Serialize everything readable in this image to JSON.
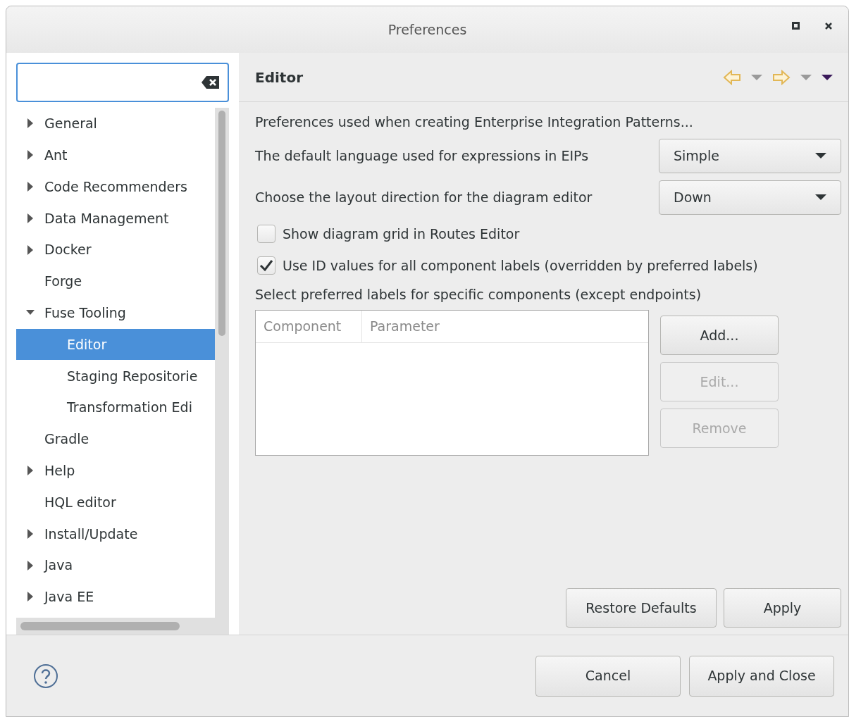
{
  "window": {
    "title": "Preferences"
  },
  "tree": [
    {
      "label": "General",
      "expanded": false,
      "selected": false
    },
    {
      "label": "Ant",
      "expanded": false,
      "selected": false
    },
    {
      "label": "Code Recommenders",
      "expanded": false,
      "selected": false
    },
    {
      "label": "Data Management",
      "expanded": false,
      "selected": false
    },
    {
      "label": "Docker",
      "expanded": false,
      "selected": false
    },
    {
      "label": "Forge",
      "selected": false
    },
    {
      "label": "Fuse Tooling",
      "expanded": true,
      "selected": false,
      "children": [
        {
          "label": "Editor",
          "selected": true
        },
        {
          "label": "Staging Repositorie",
          "selected": false
        },
        {
          "label": "Transformation Edi",
          "selected": false
        }
      ]
    },
    {
      "label": "Gradle",
      "selected": false
    },
    {
      "label": "Help",
      "expanded": false,
      "selected": false
    },
    {
      "label": "HQL editor",
      "selected": false
    },
    {
      "label": "Install/Update",
      "expanded": false,
      "selected": false
    },
    {
      "label": "Java",
      "expanded": false,
      "selected": false
    },
    {
      "label": "Java EE",
      "expanded": false,
      "selected": false
    }
  ],
  "page": {
    "title": "Editor",
    "description": "Preferences used when creating Enterprise Integration Patterns...",
    "settings": [
      {
        "kind": "dropdown",
        "label": "The default language used for expressions in EIPs",
        "value": "Simple"
      },
      {
        "kind": "dropdown",
        "label": "Choose the layout direction for the diagram editor",
        "value": "Down"
      },
      {
        "kind": "checkbox",
        "label": "Show diagram grid in Routes Editor",
        "checked": false
      },
      {
        "kind": "checkbox",
        "label": "Use ID values for all component labels (overridden by preferred labels)",
        "checked": true
      }
    ],
    "labels_caption": "Select preferred labels for specific components (except endpoints)",
    "table": {
      "columns": [
        "Component",
        "Parameter"
      ]
    },
    "table_buttons": [
      {
        "label": "Add...",
        "disabled": false
      },
      {
        "label": "Edit...",
        "disabled": true
      },
      {
        "label": "Remove",
        "disabled": true
      }
    ],
    "page_buttons": [
      "Restore Defaults",
      "Apply"
    ]
  },
  "dialog_buttons": [
    "Cancel",
    "Apply and Close"
  ]
}
